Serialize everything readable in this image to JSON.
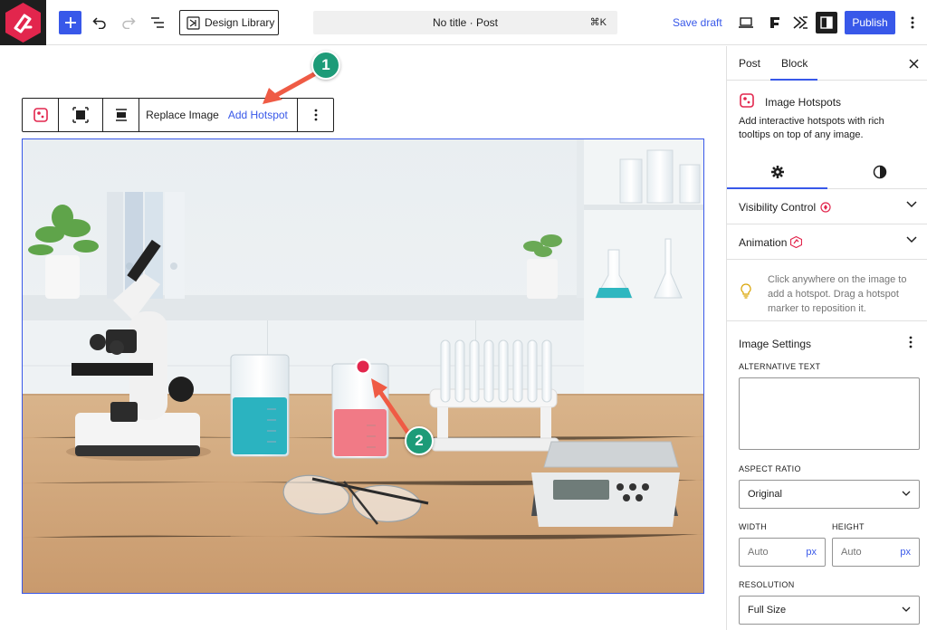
{
  "topbar": {
    "design_library_label": "Design Library",
    "doc_title": "No title · Post",
    "shortcut": "⌘K",
    "save_draft": "Save draft",
    "publish": "Publish"
  },
  "block_toolbar": {
    "replace_image": "Replace Image",
    "add_hotspot": "Add Hotspot"
  },
  "annotations": [
    "1",
    "2"
  ],
  "sidebar": {
    "tabs": [
      "Post",
      "Block"
    ],
    "block_title": "Image Hotspots",
    "block_description": "Add interactive hotspots with rich tooltips on top of any image.",
    "panels": [
      "Visibility Control",
      "Animation"
    ],
    "tip": "Click anywhere on the image to add a hotspot. Drag a hotspot marker to reposition it.",
    "image_settings": "Image Settings",
    "alt_text_label": "ALTERNATIVE TEXT",
    "alt_text_value": "",
    "aspect_ratio_label": "ASPECT RATIO",
    "aspect_ratio_value": "Original",
    "width_label": "WIDTH",
    "height_label": "HEIGHT",
    "width_placeholder": "Auto",
    "height_placeholder": "Auto",
    "unit": "px",
    "resolution_label": "RESOLUTION",
    "resolution_value": "Full Size"
  },
  "colors": {
    "accent": "#3858e9",
    "brand": "#e2264d",
    "badge": "#1d9b78",
    "arrow": "#ef5b45"
  }
}
